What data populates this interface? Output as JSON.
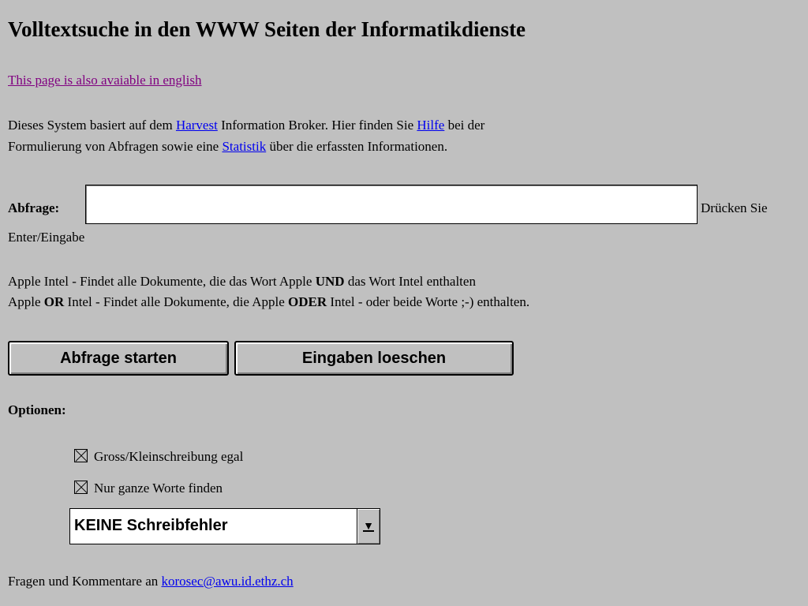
{
  "title": "Volltextsuche in den WWW Seiten der Informatikdienste",
  "english_link": "This page is also avaiable in english",
  "intro": {
    "t1": "Dieses System basiert auf dem ",
    "harvest": "Harvest",
    "t2": " Information Broker. Hier finden Sie ",
    "hilfe": "Hilfe",
    "t3": " bei der",
    "t4": "Formulierung von Abfragen sowie eine ",
    "statistik": "Statistik",
    "t5": " über die erfassten Informationen."
  },
  "query": {
    "label": "Abfrage:",
    "value": "",
    "hint1": "Drücken Sie",
    "hint2": "Enter/Eingabe"
  },
  "examples": {
    "l1a": "Apple Intel - Findet alle Dokumente, die das Wort Apple ",
    "l1b": "UND",
    "l1c": " das Wort Intel enthalten",
    "l2a": "Apple ",
    "l2b": "OR",
    "l2c": " Intel - Findet alle Dokumente, die Apple ",
    "l2d": "ODER",
    "l2e": " Intel - oder beide Worte ;-) enthalten."
  },
  "buttons": {
    "submit": "Abfrage starten",
    "reset": "Eingaben loeschen"
  },
  "options": {
    "label": "Optionen:",
    "case": "Gross/Kleinschreibung egal",
    "words": "Nur ganze Worte finden",
    "errors_selected": "KEINE Schreibfehler",
    "case_checked": true,
    "words_checked": true
  },
  "footer": {
    "text": "Fragen und Kommentare an ",
    "email": "korosec@awu.id.ethz.ch"
  }
}
